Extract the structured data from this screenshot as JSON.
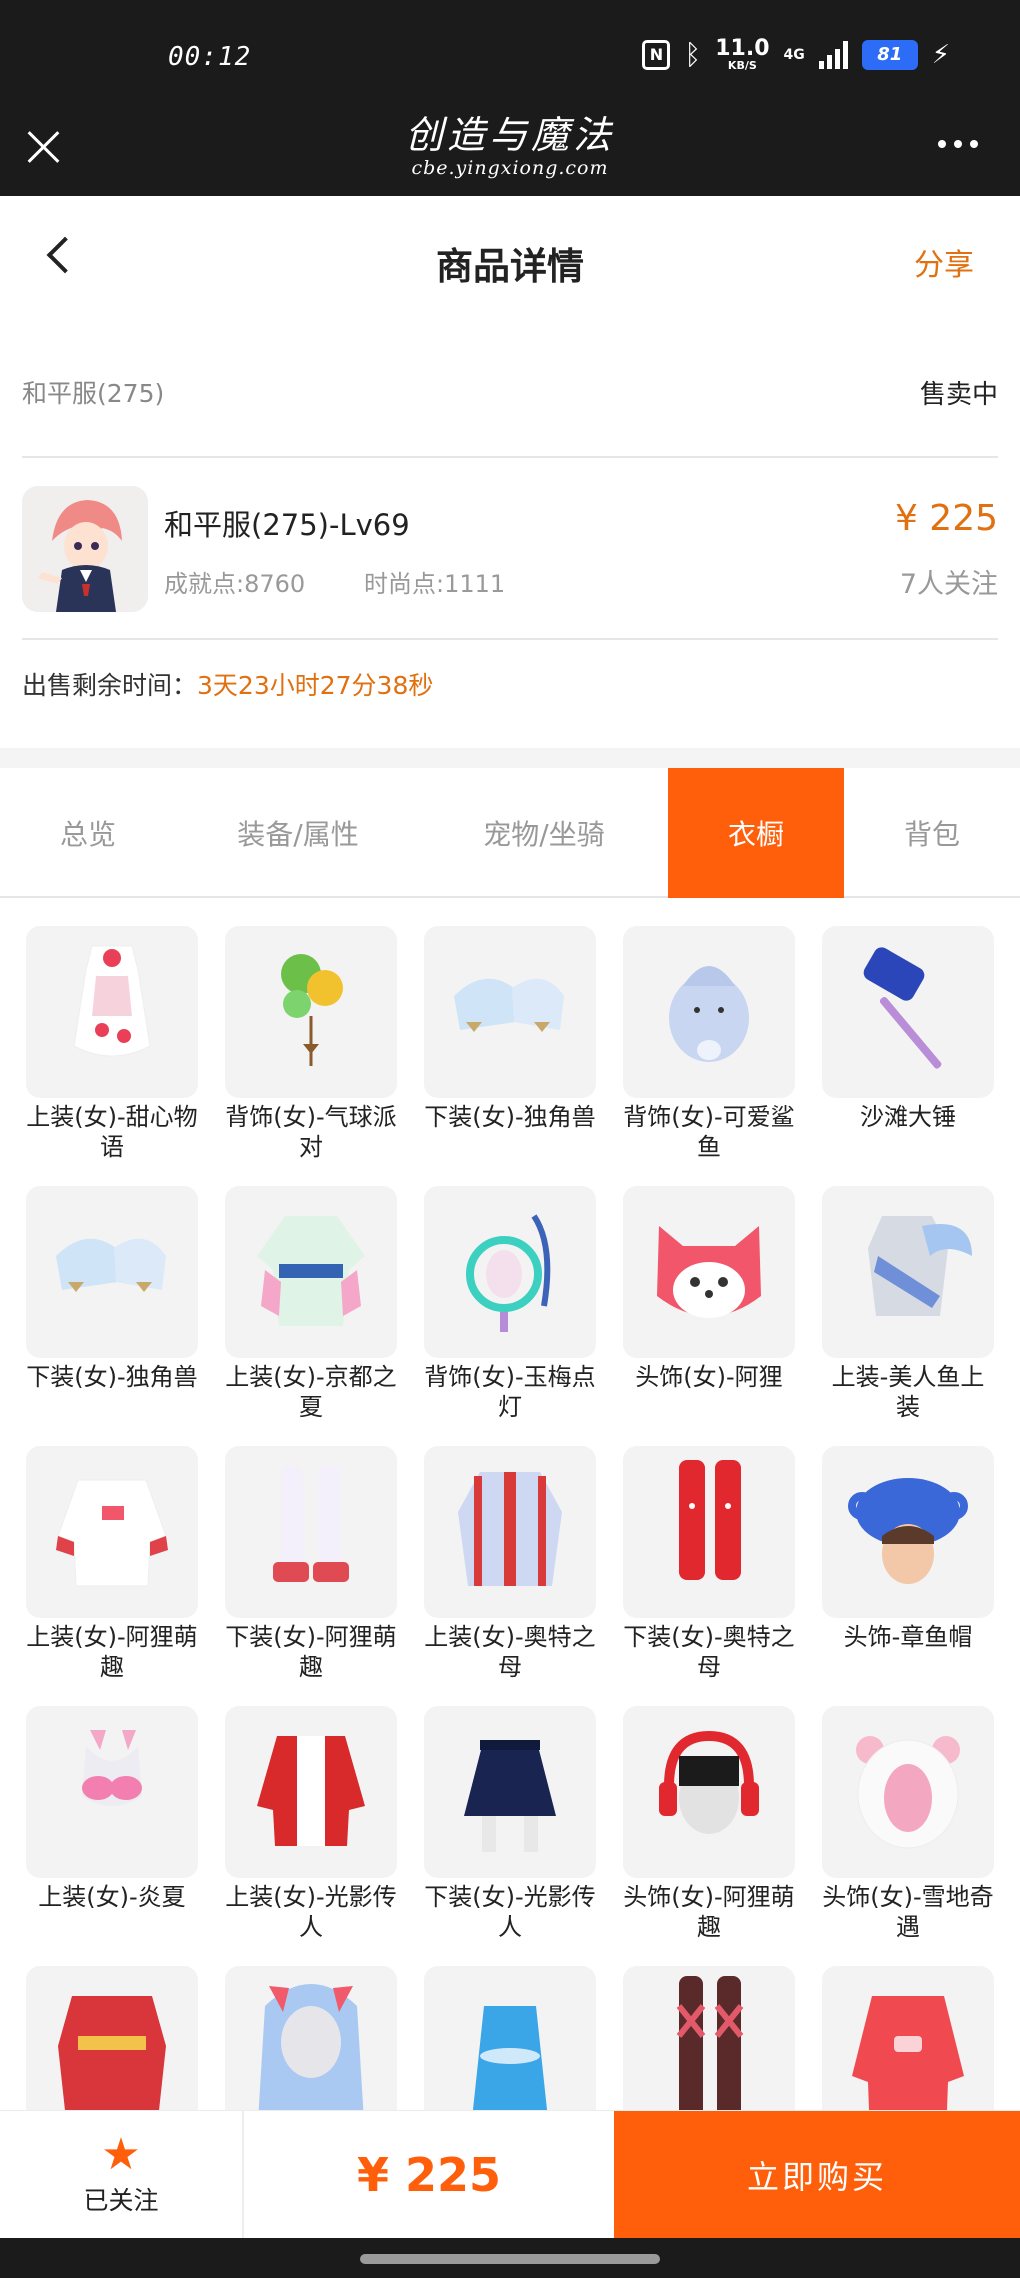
{
  "status_bar": {
    "time": "00:12",
    "nfc": "N",
    "speed": "11.0",
    "speed_unit": "KB/S",
    "network": "4G",
    "battery": "81",
    "icons": [
      "nfc-icon",
      "bluetooth-icon",
      "signal-icon",
      "battery-icon",
      "charging-icon"
    ]
  },
  "app_header": {
    "title": "创造与魔法",
    "subtitle": "cbe.yingxiong.com"
  },
  "page_header": {
    "title": "商品详情",
    "share": "分享"
  },
  "product": {
    "server": "和平服(275)",
    "status": "售卖中",
    "name": "和平服(275)-Lv69",
    "achievement": "成就点:8760",
    "fashion": "时尚点:1111",
    "price": "¥ 225",
    "followers": "7人关注",
    "remaining_label": "出售剩余时间：",
    "remaining_value": "3天23小时27分38秒"
  },
  "tabs": [
    {
      "label": "总览",
      "active": false
    },
    {
      "label": "装备/属性",
      "active": false
    },
    {
      "label": "宠物/坐骑",
      "active": false
    },
    {
      "label": "衣橱",
      "active": true
    },
    {
      "label": "背包",
      "active": false
    }
  ],
  "wardrobe": [
    {
      "name": "上装(女)-甜心物语",
      "icon": "dress-icon"
    },
    {
      "name": "背饰(女)-气球派对",
      "icon": "balloon-icon"
    },
    {
      "name": "下装(女)-独角兽",
      "icon": "boots-icon"
    },
    {
      "name": "背饰(女)-可爱鲨鱼",
      "icon": "shark-icon"
    },
    {
      "name": "沙滩大锤",
      "icon": "hammer-icon"
    },
    {
      "name": "下装(女)-独角兽",
      "icon": "boots-icon"
    },
    {
      "name": "上装(女)-京都之夏",
      "icon": "kimono-icon"
    },
    {
      "name": "背饰(女)-玉梅点灯",
      "icon": "lantern-icon"
    },
    {
      "name": "头饰(女)-阿狸",
      "icon": "fox-head-icon"
    },
    {
      "name": "上装-美人鱼上装",
      "icon": "mermaid-top-icon"
    },
    {
      "name": "上装(女)-阿狸萌趣",
      "icon": "hoodie-icon"
    },
    {
      "name": "下装(女)-阿狸萌趣",
      "icon": "stockings-icon"
    },
    {
      "name": "上装(女)-奥特之母",
      "icon": "suit-top-icon"
    },
    {
      "name": "下装(女)-奥特之母",
      "icon": "red-boots-icon"
    },
    {
      "name": "头饰-章鱼帽",
      "icon": "octopus-hat-icon"
    },
    {
      "name": "上装(女)-炎夏",
      "icon": "bikini-icon"
    },
    {
      "name": "上装(女)-光影传人",
      "icon": "jacket-icon"
    },
    {
      "name": "下装(女)-光影传人",
      "icon": "skirt-icon"
    },
    {
      "name": "头饰(女)-阿狸萌趣",
      "icon": "headphones-icon"
    },
    {
      "name": "头饰(女)-雪地奇遇",
      "icon": "bear-hood-icon"
    },
    {
      "name": "",
      "icon": "red-robe-icon"
    },
    {
      "name": "",
      "icon": "blue-hair-icon"
    },
    {
      "name": "",
      "icon": "blue-dress-icon"
    },
    {
      "name": "",
      "icon": "leg-wrap-icon"
    },
    {
      "name": "",
      "icon": "red-hoodie-icon"
    }
  ],
  "bottom_bar": {
    "follow_label": "已关注",
    "price": "¥ 225",
    "buy": "立即购买"
  },
  "colors": {
    "accent": "#ff5f0b",
    "price": "#e07010",
    "header_bg": "#1b1b1b"
  }
}
